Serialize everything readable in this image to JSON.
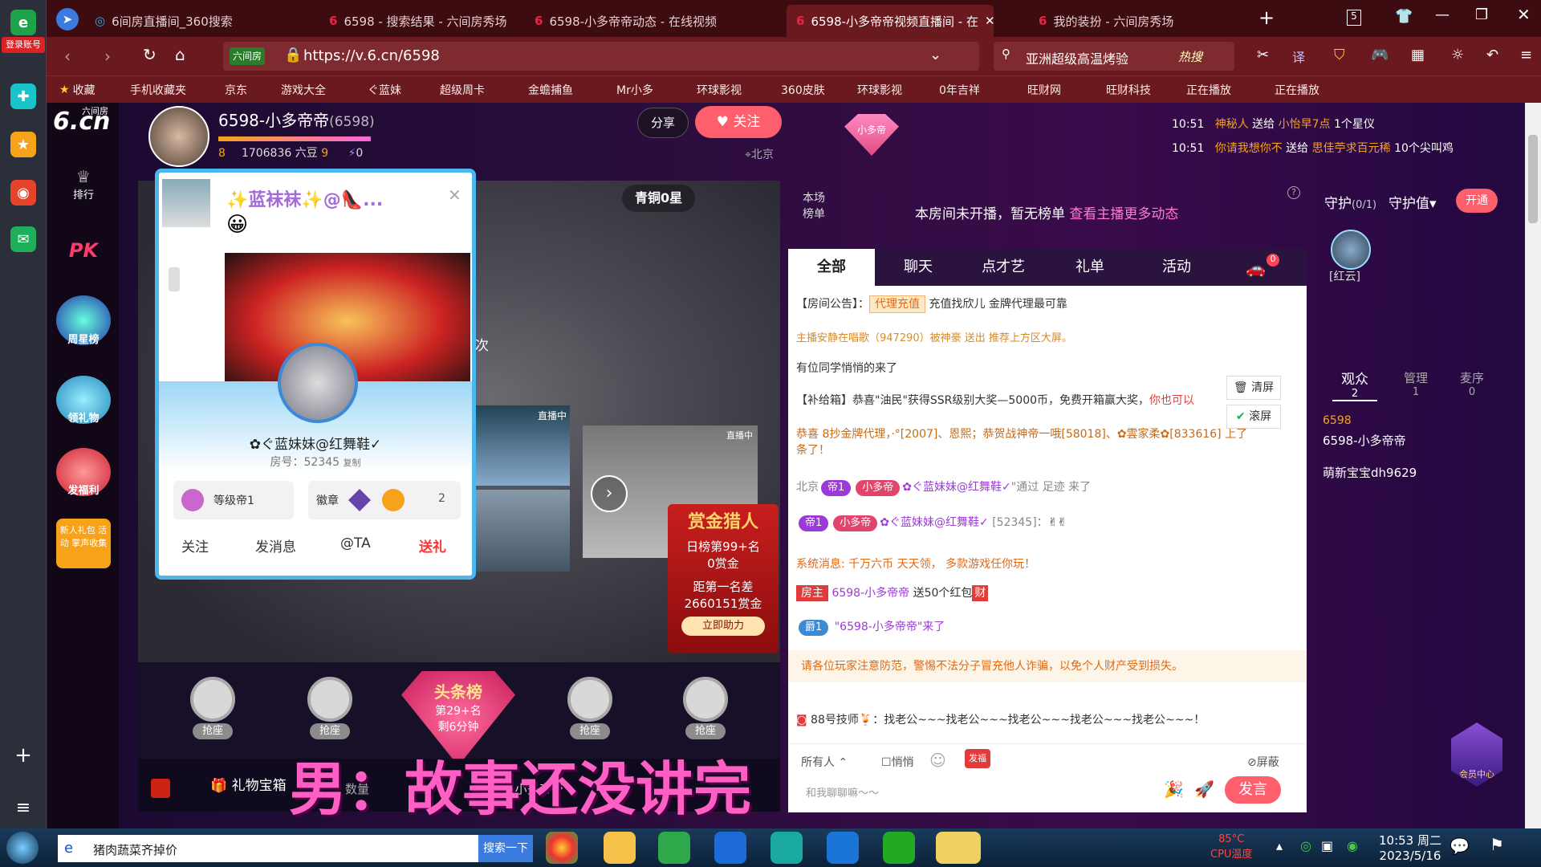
{
  "dock": {
    "login_label": "登录账号"
  },
  "tabs": [
    {
      "title": "6间房直播间_360搜索"
    },
    {
      "title": "6598 - 搜索结果 - 六间房秀场"
    },
    {
      "title": "6598-小多帝帝动态 - 在线视频"
    },
    {
      "title": "6598-小多帝帝视频直播间 - 在"
    },
    {
      "title": "我的装扮 - 六间房秀场"
    }
  ],
  "address": {
    "site_badge": "六间房",
    "url": "https://v.6.cn/6598",
    "search_text": "亚洲超级高温烤验",
    "hot_label": "热搜",
    "tab_count": "5"
  },
  "bookmarks": [
    "收藏",
    "手机收藏夹",
    "京东",
    "游戏大全",
    "ぐ蓝妹",
    "超级周卡",
    "金蟾捕鱼",
    "Mr小多",
    "环球影视",
    "360皮肤",
    "环球影视",
    "0年吉祥",
    "旺财网",
    "旺财科技",
    "正在播放",
    "正在播放"
  ],
  "site": {
    "logo": "6.cn",
    "logo_sub": "六间房",
    "nav": [
      {
        "label": "排行"
      },
      {
        "label": "PK"
      },
      {
        "label": "周星榜"
      },
      {
        "label": "领礼物"
      },
      {
        "label": "发福利"
      },
      {
        "label": "新人礼包 活动 掌声收集"
      }
    ]
  },
  "streamer": {
    "name": "6598-小多帝帝",
    "room": "(6598)",
    "beans": "1706836 六豆",
    "level_left": "8",
    "level_right": "9",
    "flash_count": "0",
    "location": "北京",
    "share": "分享",
    "follow": "关注",
    "tag": "小多帝"
  },
  "announcements": [
    {
      "time": "10:51",
      "from": "神秘人",
      "verb": "送给",
      "to": "小怡早7点",
      "gift": "1个星仪"
    },
    {
      "time": "10:51",
      "from": "你请我想你不",
      "verb": "送给",
      "to": "思佳苧求百元稀",
      "gift": "10个尖叫鸡"
    }
  ],
  "video": {
    "rank_label": "青铜0星",
    "overlay_live1": "直播中",
    "overlay_live2": "直播中",
    "left_text": "次"
  },
  "card": {
    "title": "✨蓝袜袜✨@👠...",
    "user_name": "✿ぐ蓝妹妹@红舞鞋✓",
    "room_no": "房号：52345",
    "copy": "复制",
    "level": "等级帝1",
    "medal": "徽章",
    "medal_count": "2",
    "actions": [
      "关注",
      "发消息",
      "@TA",
      "送礼"
    ]
  },
  "bounty": {
    "title": "赏金猎人",
    "rank": "日榜第99+名",
    "gold": "0赏金",
    "gap_title": "距第一名差",
    "gap_value": "2660151赏金",
    "button": "立即助力"
  },
  "seats": {
    "seat_label": "抢座",
    "headline_title": "头条榜",
    "headline_rank": "第29+名",
    "headline_time": "剩6分钟"
  },
  "gift": {
    "box_label": "礼物宝箱",
    "qty_label": "数量",
    "target": "6598-小多帝帝"
  },
  "subtitle": "男：故事还没讲完",
  "ranking": {
    "label": "本场榜单",
    "empty": "本房间未开播，暂无榜单",
    "link": "查看主播更多动态"
  },
  "chat_tabs": [
    "全部",
    "聊天",
    "点才艺",
    "礼单",
    "活动"
  ],
  "car_badge": "0",
  "chat": {
    "notice_prefix": "【房间公告】：",
    "notice_tag": "代理充值",
    "notice_text": "充值找欣儿 金牌代理最可靠",
    "line1": "主播安静在唱歌（947290）被神豪 送出 推荐上方区大屏。",
    "line2": "有位同学悄悄的来了",
    "line3_a": "【补给箱】恭喜\"油民\"获得SSR级别大奖—5000币，免费开箱赢大奖，",
    "line3_b": "你也可以",
    "line4_a": "恭喜 8抄金牌代理，·°[2007]、恩熙；恭贺战神帝一哦[58018]、✿雲家柔✿[833616] 上了",
    "line4_b": "条了！",
    "enter_loc": "北京",
    "enter_badge1": "帝1",
    "enter_badge2": "小多帝",
    "enter_user": "✿ぐ蓝妹妹@红舞鞋✓",
    "enter_tail": "\"通过 足迹 来了",
    "speak_badge": "帝1",
    "speak_badge2": "小多帝",
    "speak_user": "✿ぐ蓝妹妹@红舞鞋✓",
    "speak_room": "[52345]：",
    "sys": "系统消息: 千万六币 天天领， 多款游戏任你玩！",
    "host_tag": "房主",
    "host_name": "6598-小多帝帝",
    "host_action": "送50个红包",
    "host_icon": "财",
    "noble_badge": "爵1",
    "noble_user": "\"6598-小多帝帝\"来了",
    "warning": "请各位玩家注意防范，警惕不法分子冒充他人诈骗，以免个人财产受到损失。",
    "bottom": "88号技师🍹：找老公~~~找老公~~~找老公~~~找老公~~~找老公~~~！",
    "clear": "清屏",
    "scroll": "滚屏",
    "audience_select": "所有人",
    "whisper": "悄悄",
    "fuli": "发福利",
    "shield": "屏蔽",
    "input_placeholder": "和我聊聊嘛～～",
    "send": "发言"
  },
  "guard": {
    "label": "守护",
    "count": "(0/1)",
    "value_label": "守护值",
    "open": "开通",
    "member": "[红云]"
  },
  "audience": {
    "tabs": [
      {
        "label": "观众",
        "count": "2"
      },
      {
        "label": "管理",
        "count": "1"
      },
      {
        "label": "麦序",
        "count": "0"
      }
    ],
    "users": [
      {
        "lvl": "6598",
        "name": "6598-小多帝帝"
      },
      {
        "name": "萌新宝宝dh9629"
      }
    ],
    "member_center": "会员中心"
  },
  "taskbar": {
    "search_text": "猪肉蔬菜齐掉价",
    "search_button": "搜索一下",
    "temp": "85°C",
    "temp_label": "CPU温度",
    "time": "10:53 周二",
    "date": "2023/5/16"
  }
}
